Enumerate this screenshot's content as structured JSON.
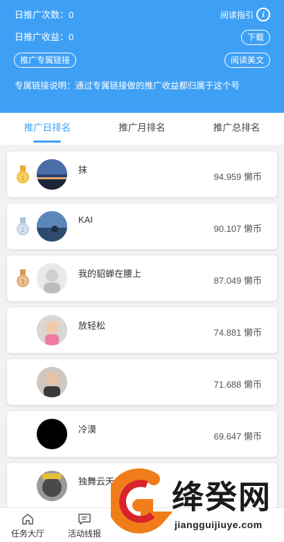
{
  "header": {
    "daily_count_label": "日推广次数：",
    "daily_count_value": "0",
    "daily_income_label": "日推广收益：",
    "daily_income_value": "0",
    "exclusive_link_button": "推广专属链接",
    "guide_label": "阅读指引",
    "guide_icon": "i",
    "download_button": "下载",
    "read_article_button": "阅读美文",
    "description": "专属链接说明：通过专属链接做的推广收益都归属于这个号"
  },
  "tabs": [
    {
      "label": "推广日排名",
      "active": true
    },
    {
      "label": "推广月排名",
      "active": false
    },
    {
      "label": "推广总排名",
      "active": false
    }
  ],
  "colors": {
    "accent": "#3ea0f5",
    "gold": "#e8a93a",
    "silver": "#a8c3da",
    "bronze": "#d49a5a"
  },
  "ranking": [
    {
      "rank": 1,
      "medal": "gold-medal-icon",
      "name": "抹",
      "score": "94.959 懒币"
    },
    {
      "rank": 2,
      "medal": "silver-medal-icon",
      "name": "KAI",
      "score": "90.107 懒币"
    },
    {
      "rank": 3,
      "medal": "bronze-medal-icon",
      "name": "我的貂蝉在腰上",
      "score": "87.049 懒币"
    },
    {
      "rank": 4,
      "medal": "",
      "name": "放轻松",
      "score": "74.881 懒币"
    },
    {
      "rank": 5,
      "medal": "",
      "name": "",
      "score": "71.688 懒币"
    },
    {
      "rank": 6,
      "medal": "",
      "name": "冷漠",
      "score": "69.647 懒币"
    },
    {
      "rank": 7,
      "medal": "",
      "name": "独舞云天",
      "score": ""
    }
  ],
  "footer": {
    "items": [
      {
        "label": "任务大厅",
        "icon": "home-icon"
      },
      {
        "label": "活动线报",
        "icon": "message-icon"
      }
    ]
  },
  "watermark": {
    "text": "绛癸网",
    "url": "jiangguijiuye.com"
  }
}
